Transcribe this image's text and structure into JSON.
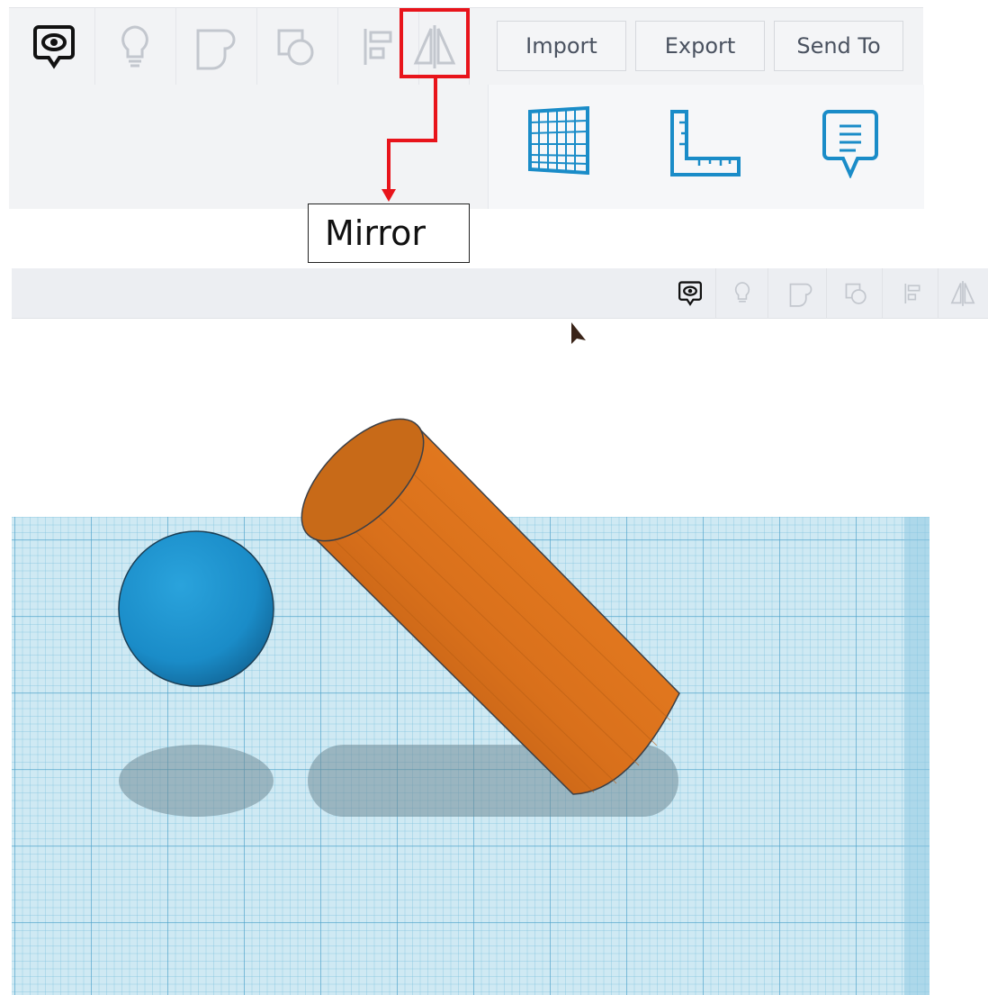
{
  "toolbar": {
    "tools": [
      {
        "name": "notes-toggle",
        "icon": "eye-speech-bubble-icon"
      },
      {
        "name": "lightbulb",
        "icon": "lightbulb-icon"
      },
      {
        "name": "group",
        "icon": "group-shapes-icon"
      },
      {
        "name": "ungroup",
        "icon": "ungroup-shapes-icon"
      },
      {
        "name": "align",
        "icon": "align-icon"
      },
      {
        "name": "mirror",
        "icon": "mirror-icon"
      }
    ],
    "import_label": "Import",
    "export_label": "Export",
    "sendto_label": "Send To"
  },
  "panel": {
    "tools": [
      {
        "name": "workplane",
        "icon": "workplane-grid-icon"
      },
      {
        "name": "ruler",
        "icon": "ruler-icon"
      },
      {
        "name": "notes",
        "icon": "note-icon"
      }
    ]
  },
  "callout": {
    "label": "Mirror",
    "highlight_color": "#e8141b"
  },
  "viewport": {
    "objects": [
      {
        "type": "sphere",
        "color": "#1a8cc8"
      },
      {
        "type": "cylinder",
        "color": "#e5781e"
      }
    ],
    "grid_color": "#cfe9f3"
  }
}
